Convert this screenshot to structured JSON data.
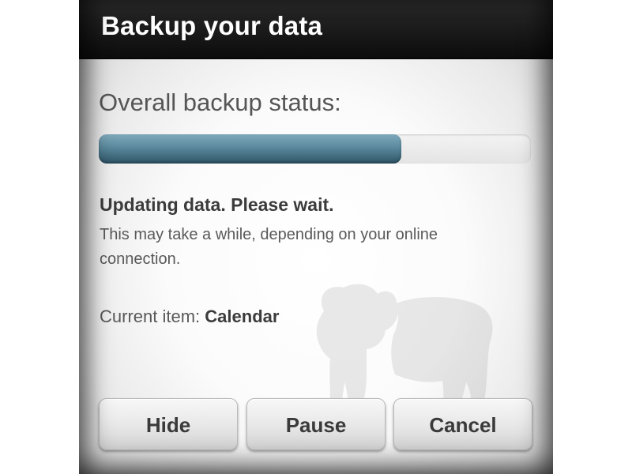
{
  "dialog": {
    "title": "Backup your data"
  },
  "status": {
    "heading": "Overall backup status:",
    "progress_percent": 70,
    "message": "Updating data. Please wait.",
    "detail": "This may take a while, depending on your online connection.",
    "current_item_label": "Current item:",
    "current_item_value": "Calendar"
  },
  "buttons": {
    "hide": "Hide",
    "pause": "Pause",
    "cancel": "Cancel"
  },
  "colors": {
    "titlebar": "#111111",
    "progress_fill": "#4f7f94",
    "progress_track": "#e6e6e6"
  },
  "icons": {
    "background_mascot": "bulldog-silhouette-icon"
  }
}
